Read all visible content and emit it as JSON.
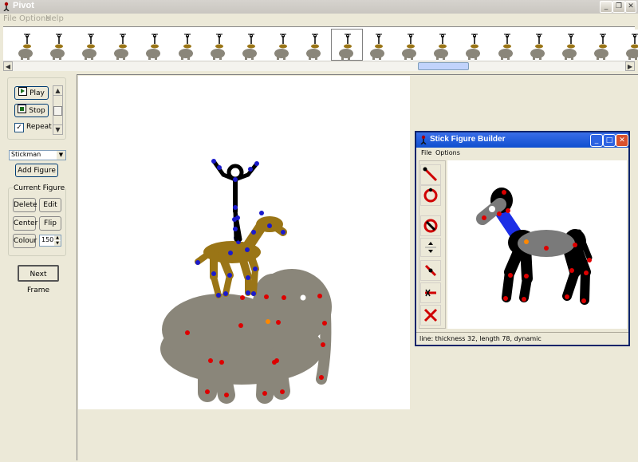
{
  "window": {
    "title": "Pivot"
  },
  "menu": {
    "file": "File",
    "options": "Options",
    "help": "Help"
  },
  "frames": {
    "count": 20,
    "selected_index": 10
  },
  "controls": {
    "play": "Play",
    "stop": "Stop",
    "repeat": "Repeat",
    "repeat_checked": true,
    "figure_select": "Stickman",
    "add_figure": "Add Figure",
    "current_figure": "Current Figure",
    "delete": "Delete",
    "edit": "Edit",
    "center": "Center",
    "flip": "Flip",
    "colour": "Colour",
    "colour_value": "150",
    "next_frame": "Next Frame"
  },
  "builder": {
    "title": "Stick Figure Builder",
    "menu_file": "File",
    "menu_options": "Options",
    "status": "line: thickness 32, length 78, dynamic",
    "tools": [
      "line-tool-icon",
      "circle-tool-icon",
      "no-circle-tool-icon",
      "move-up-down-icon",
      "joint-tool-icon",
      "cut-tool-icon",
      "delete-icon"
    ]
  },
  "colors": {
    "elephant": "#8a867a",
    "horse": "#9a7516",
    "stickman": "#000000",
    "joint_red": "#dd0000",
    "joint_blue": "#1a1acc",
    "joint_orange": "#ff8800",
    "builder_horse_gray": "#7a7a7a",
    "builder_neck": "#1c2ee6"
  }
}
